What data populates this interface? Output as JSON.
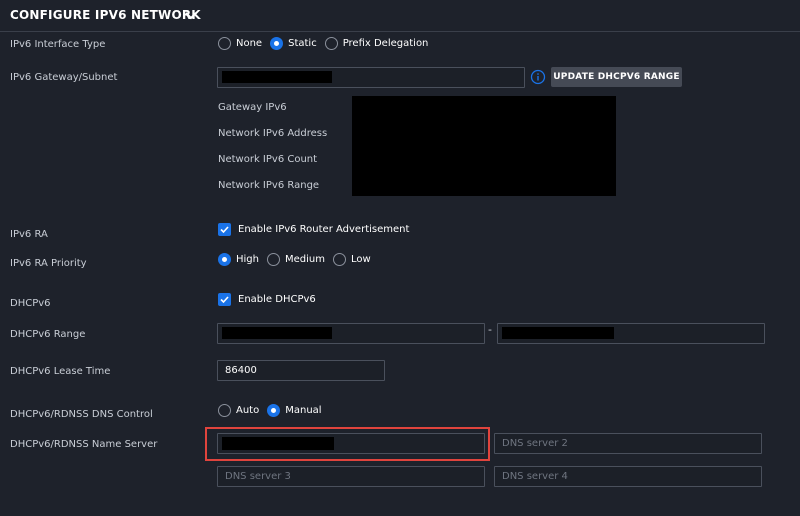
{
  "header": {
    "title": "CONFIGURE IPV6 NETWORK",
    "chevron_icon": "chevron-down-icon"
  },
  "interface_type": {
    "label": "IPv6 Interface Type",
    "options": [
      {
        "label": "None",
        "selected": false
      },
      {
        "label": "Static",
        "selected": true
      },
      {
        "label": "Prefix Delegation",
        "selected": false
      }
    ]
  },
  "gateway_subnet": {
    "label": "IPv6 Gateway/Subnet",
    "value": "",
    "info_icon": "info-icon",
    "update_button": "UPDATE DHCPV6 RANGE",
    "details": [
      {
        "label": "Gateway IPv6"
      },
      {
        "label": "Network IPv6 Address"
      },
      {
        "label": "Network IPv6 Count"
      },
      {
        "label": "Network IPv6 Range"
      }
    ]
  },
  "ra": {
    "label": "IPv6 RA",
    "checkbox_label": "Enable IPv6 Router Advertisement",
    "checked": true
  },
  "ra_priority": {
    "label": "IPv6 RA Priority",
    "options": [
      {
        "label": "High",
        "selected": true
      },
      {
        "label": "Medium",
        "selected": false
      },
      {
        "label": "Low",
        "selected": false
      }
    ]
  },
  "dhcpv6": {
    "label": "DHCPv6",
    "checkbox_label": "Enable DHCPv6",
    "checked": true
  },
  "dhcpv6_range": {
    "label": "DHCPv6 Range",
    "separator": "-",
    "start": "",
    "end": ""
  },
  "lease_time": {
    "label": "DHCPv6 Lease Time",
    "value": "86400"
  },
  "dns_control": {
    "label": "DHCPv6/RDNSS DNS Control",
    "options": [
      {
        "label": "Auto",
        "selected": false
      },
      {
        "label": "Manual",
        "selected": true
      }
    ]
  },
  "name_server": {
    "label": "DHCPv6/RDNSS Name Server",
    "server1_value": "",
    "server2_placeholder": "DNS server 2",
    "server3_placeholder": "DNS server 3",
    "server4_placeholder": "DNS server 4"
  },
  "colors": {
    "accent": "#1a73e8",
    "highlight": "#e0443d",
    "background": "#1e222b"
  }
}
